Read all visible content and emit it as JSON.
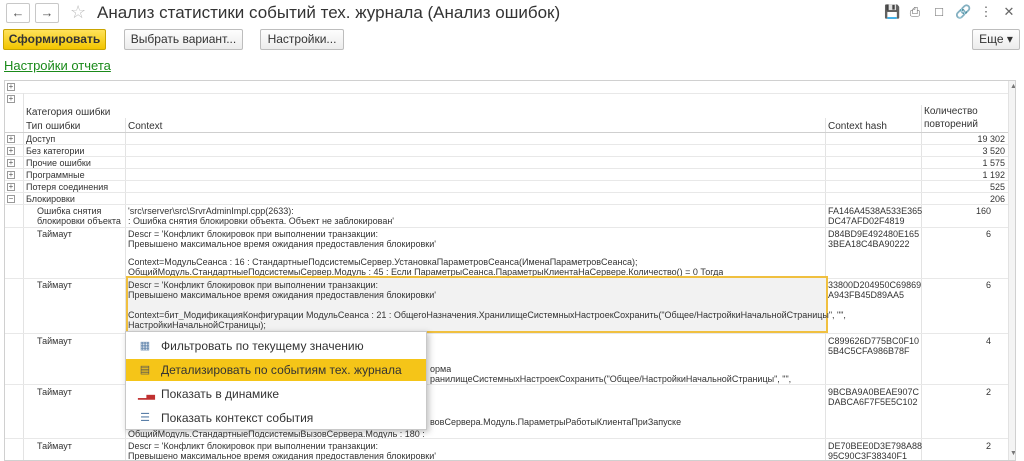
{
  "window": {
    "title": "Анализ статистики событий тех. журнала (Анализ ошибок)"
  },
  "toolbar": {
    "generate_label": "Сформировать",
    "select_variant_label": "Выбрать вариант...",
    "settings_label": "Настройки...",
    "more_label": "Еще"
  },
  "report_settings_link": "Настройки отчета",
  "table": {
    "header": {
      "category": "Категория ошибки",
      "type": "Тип ошибки",
      "context": "Context",
      "hash": "Context hash",
      "count_line1": "Количество",
      "count_line2": "повторений"
    },
    "groups": [
      {
        "name": "Доступ",
        "count": "19 302"
      },
      {
        "name": "Без категории",
        "count": "3 520"
      },
      {
        "name": "Прочие ошибки",
        "count": "1 575"
      },
      {
        "name": "Программные",
        "count": "1 192"
      },
      {
        "name": "Потеря соединения",
        "count": "525"
      },
      {
        "name": "Блокировки",
        "count": "206"
      }
    ],
    "rows": [
      {
        "type_l1": "Ошибка снятия",
        "type_l2": "блокировки объекта",
        "ctx1": "'src\\rserver\\src\\SrvrAdminImpl.cpp(2633):",
        "ctx2": ": Ошибка снятия блокировки объекта. Объект не заблокирован'",
        "hash1": "FA146A4538A533E365",
        "hash2": "DC47AFD02F4819",
        "count": "160"
      },
      {
        "type": "Таймаут",
        "ctx1": "Descr = 'Конфликт блокировок при выполнении транзакции:",
        "ctx2": "Превышено максимальное время ожидания предоставления блокировки'",
        "ctx3": "Context=МодульСеанса : 16 : СтандартныеПодсистемыСервер.УстановкаПараметровСеанса(ИменаПараметровСеанса);",
        "ctx4": "    ОбщийМодуль.СтандартныеПодсистемыСервер.Модуль : 45 : Если ПараметрыСеанса.ПараметрыКлиентаНаСервере.Количество() = 0 Тогда",
        "hash1": "D84BD9E492480E165",
        "hash2": "3BEA18C4BA90222",
        "count": "6"
      },
      {
        "type": "Таймаут",
        "ctx1": "Descr = 'Конфликт блокировок при выполнении транзакции:",
        "ctx2": "Превышено максимальное время ожидания предоставления блокировки'",
        "ctx3": "Context=бит_МодификацияКонфигурации МодульСеанса : 21 : ОбщегоНазначения.ХранилищеСистемныхНастроекСохранить(\"Общее/НастройкиНачальнойСтраницы\", \"\",",
        "ctx4": "НастройкиНачальнойСтраницы);",
        "hash1": "33800D204950C69869",
        "hash2": "A943FB45D89AA5",
        "count": "6"
      },
      {
        "type": "Таймаут",
        "ctx_partial1": "орма",
        "ctx_partial2": "ранилищеСистемныхНастроекСохранить(\"Общее/НастройкиНачальнойСтраницы\", \"\",",
        "hash1": "C899626D775BC0F10",
        "hash2": "5B4C5CFA986B78F",
        "count": "4"
      },
      {
        "type": "Таймаут",
        "ctx_partial1": "вовСервера.Модуль.ПараметрыРаботыКлиентаПриЗапуске",
        "ctx_partial2": "ОбщийМодуль.СтандартныеПодсистемыВызовСервера.Модуль : 180 :",
        "hash1": "9BCBA9A0BEAE907C",
        "hash2": "DABCA6F7F5E5C102",
        "count": "2"
      },
      {
        "type": "Таймаут",
        "ctx1": "Descr = 'Конфликт блокировок при выполнении транзакции:",
        "ctx2": "Превышено максимальное время ожидания предоставления блокировки'",
        "hash1": "DE70BEE0D3E798A88",
        "hash2": "95C90C3F38340F1",
        "count": "2"
      }
    ]
  },
  "context_menu": {
    "items": [
      {
        "label": "Фильтровать по текущему значению",
        "icon": "filter-icon"
      },
      {
        "label": "Детализировать по событиям тех. журнала",
        "icon": "details-icon"
      },
      {
        "label": "Показать в динамике",
        "icon": "chart-icon"
      },
      {
        "label": "Показать контекст события",
        "icon": "context-icon"
      }
    ]
  },
  "colors": {
    "primary_button": "#f2c500",
    "link": "#1a8a1a",
    "menu_highlight": "#f5c518",
    "selection_border": "#f0c040"
  }
}
